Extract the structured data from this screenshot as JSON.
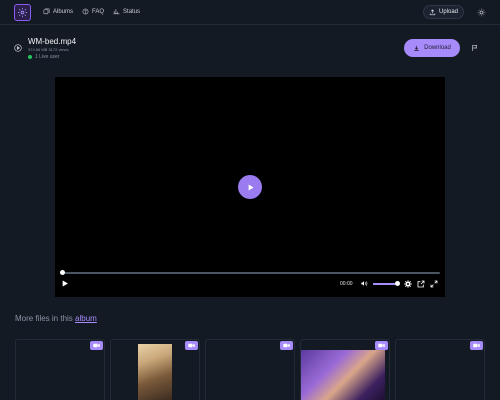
{
  "nav": {
    "items": [
      {
        "label": "Albums",
        "icon": "albums-icon"
      },
      {
        "label": "FAQ",
        "icon": "help-circle-icon"
      },
      {
        "label": "Status",
        "icon": "bar-chart-icon"
      }
    ],
    "upload_label": "Upload"
  },
  "file": {
    "title": "WM-bed.mp4",
    "meta": "374.66 MB   3172 views",
    "live_text": "1 Live user",
    "download_label": "Download"
  },
  "player": {
    "time": "00:00",
    "volume": 0.9,
    "progress": 0.0
  },
  "more": {
    "prefix": "More files in this ",
    "link": "album"
  },
  "colors": {
    "background": "#141a24",
    "accent": "#a78bfa",
    "live": "#22c55e"
  }
}
